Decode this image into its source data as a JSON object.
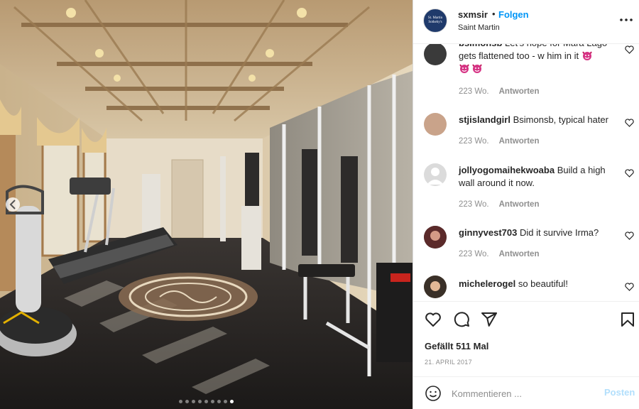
{
  "post": {
    "username": "sxmsir",
    "separator": "•",
    "follow_label": "Folgen",
    "location": "Saint Martin",
    "avatar_text": "St. Martin Sotheby's"
  },
  "photo": {
    "alt": "Home gym interior with treadmill, weight machines and monogram floor medallion",
    "carousel_count": 9,
    "carousel_active": 8
  },
  "comments": [
    {
      "username": "bsimonsb",
      "text": "Let's hope for Mara Lago gets flattened too - w him in it",
      "emoji_trailing": "devil-emoji",
      "emoji_line2": [
        "devil-emoji",
        "devil-emoji"
      ],
      "age": "223 Wo.",
      "reply_label": "Antworten"
    },
    {
      "username": "stjislandgirl",
      "text": "Bsimonsb, typical hater",
      "age": "223 Wo.",
      "reply_label": "Antworten"
    },
    {
      "username": "jollyogomaihekwoaba",
      "text": "Build a high wall around it now.",
      "age": "223 Wo.",
      "reply_label": "Antworten"
    },
    {
      "username": "ginnyvest703",
      "text": "Did it survive Irma?",
      "age": "223 Wo.",
      "reply_label": "Antworten"
    },
    {
      "username": "michelerogel",
      "text": "so beautiful!",
      "age": "",
      "reply_label": ""
    }
  ],
  "actions": {
    "likes_text": "Gefällt 511 Mal",
    "date": "21. APRIL 2017"
  },
  "composer": {
    "placeholder": "Kommentieren ...",
    "post_label": "Posten"
  },
  "colors": {
    "link_blue": "#0095f6",
    "muted": "#8e8e8e",
    "post_disabled": "#b2dffc"
  }
}
